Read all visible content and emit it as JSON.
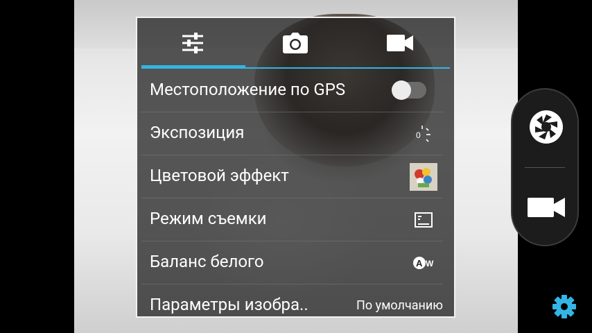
{
  "tabs": [
    {
      "name": "settings-tab",
      "icon": "sliders-icon",
      "active": true
    },
    {
      "name": "camera-tab",
      "icon": "camera-icon",
      "active": false
    },
    {
      "name": "video-tab",
      "icon": "video-camera-icon",
      "active": false
    }
  ],
  "accent_color": "#33b5e5",
  "settings": {
    "gps": {
      "label": "Местоположение по GPS",
      "control": "toggle",
      "on": false
    },
    "exposure": {
      "label": "Экспозиция",
      "value": "0",
      "icon": "exposure-icon"
    },
    "color_effect": {
      "label": "Цветовой эффект",
      "icon": "color-effect-thumbnail-icon"
    },
    "scene_mode": {
      "label": "Режим съемки",
      "icon": "scene-mode-icon"
    },
    "white_balance": {
      "label": "Баланс белого",
      "icon": "auto-white-balance-icon",
      "icon_text": "AW"
    },
    "image_params": {
      "label": "Параметры изобра..",
      "value": "По умолчанию"
    }
  },
  "side_panel": {
    "shutter_icon": "shutter-icon",
    "video_icon": "video-camera-icon",
    "settings_icon": "gear-icon",
    "settings_icon_color": "#33b5e5"
  }
}
